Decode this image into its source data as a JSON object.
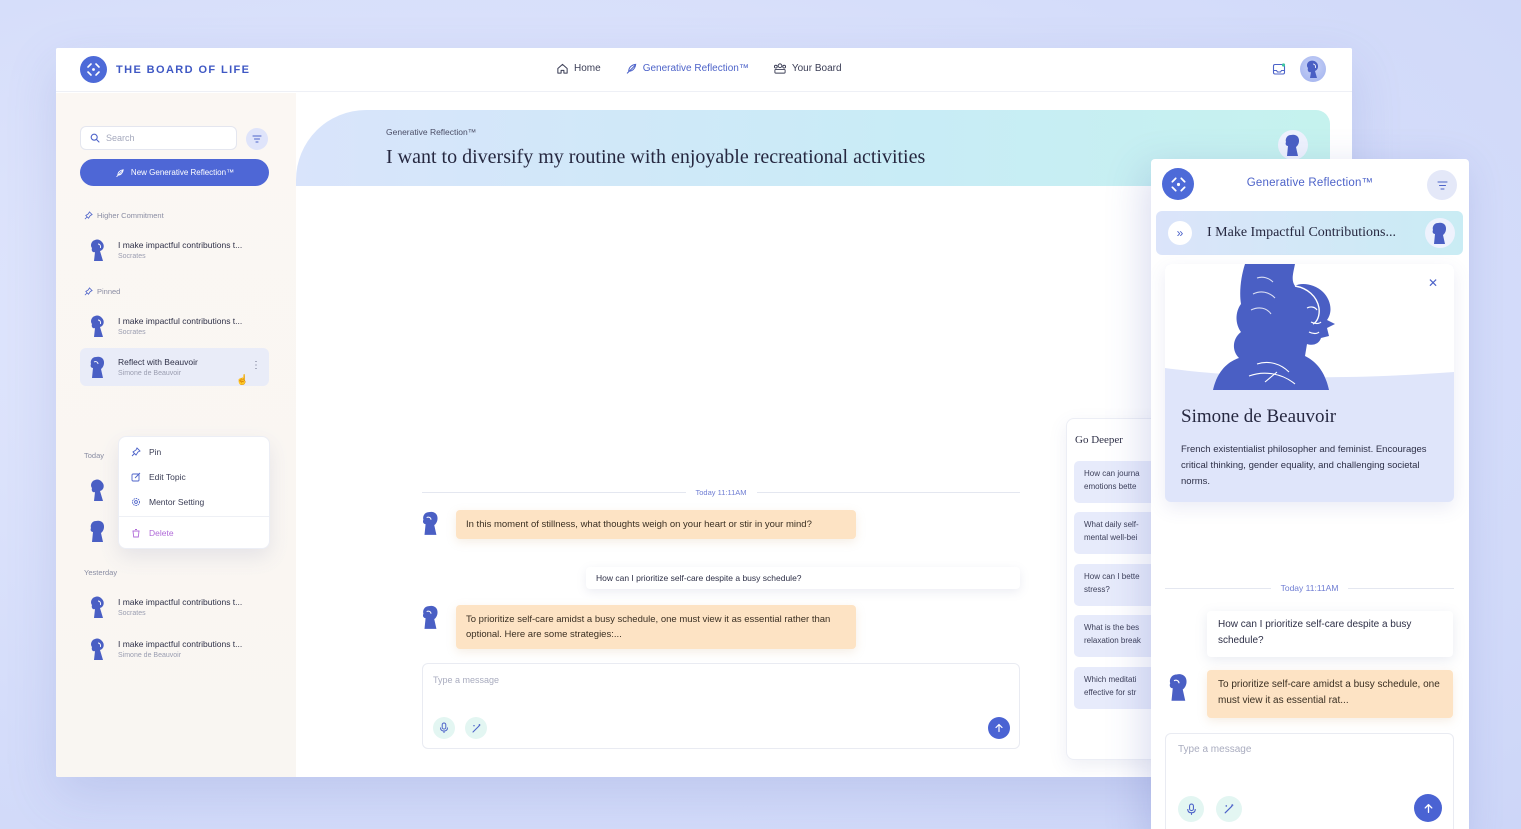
{
  "app": {
    "name": "THE BOARD OF LIFE"
  },
  "nav": {
    "home": "Home",
    "generative": "Generative Reflection™",
    "board": "Your Board"
  },
  "sidebar": {
    "search_placeholder": "Search",
    "new_button": "New Generative Reflection™",
    "higher_commitment_label": "Higher Commitment",
    "pinned_label": "Pinned",
    "today_label": "Today",
    "yesterday_label": "Yesterday",
    "higher_commitment": [
      {
        "title": "I make impactful contributions t...",
        "mentor": "Socrates"
      }
    ],
    "pinned": [
      {
        "title": "I make impactful contributions t...",
        "mentor": "Socrates"
      },
      {
        "title": "Reflect with Beauvoir",
        "mentor": "Simone de Beauvoir"
      }
    ],
    "yesterday": [
      {
        "title": "I make impactful contributions t...",
        "mentor": "Socrates"
      },
      {
        "title": "I make impactful contributions t...",
        "mentor": "Simone de Beauvoir"
      }
    ]
  },
  "context_menu": {
    "pin": "Pin",
    "edit": "Edit Topic",
    "mentor": "Mentor Setting",
    "delete": "Delete"
  },
  "conversation": {
    "label": "Generative Reflection™",
    "title": "I want to diversify my routine with enjoyable recreational activities",
    "timestamp": "Today 11:11AM",
    "ai_message_1": "In this moment of stillness, what thoughts weigh on your heart or stir in your mind?",
    "user_message_1": "How can I prioritize self-care despite a busy schedule?",
    "ai_message_2": "To prioritize self-care amidst a busy schedule, one must view it as essential rather than optional. Here are some strategies:...",
    "composer_placeholder": "Type a message"
  },
  "go_deeper": {
    "title": "Go Deeper",
    "cards": [
      {
        "line1": "How can journa",
        "line2": "emotions bette"
      },
      {
        "line1": "What daily self-",
        "line2": "mental well-bei"
      },
      {
        "line1": "How can I bette",
        "line2": "stress?"
      },
      {
        "line1": "What is the bes",
        "line2": "relaxation break"
      },
      {
        "line1": "Which meditati",
        "line2": "effective for str"
      }
    ]
  },
  "panel": {
    "title": "Generative Reflection™",
    "topic": "I Make Impactful Contributions...",
    "mentor_name": "Simone de Beauvoir",
    "mentor_desc": "French existentialist philosopher and feminist. Encourages critical thinking, gender equality, and challenging societal norms.",
    "timestamp": "Today 11:11AM",
    "user_message": "How can I prioritize self-care despite a busy schedule?",
    "ai_message": "To prioritize self-care amidst a busy schedule, one must view it as essential rat...",
    "composer_placeholder": "Type a message"
  },
  "colors": {
    "brand": "#4d6ad8",
    "ai_bubble": "#fde3c4",
    "header_gradient_start": "#d9e4fb",
    "header_gradient_end": "#c5f2ee"
  }
}
